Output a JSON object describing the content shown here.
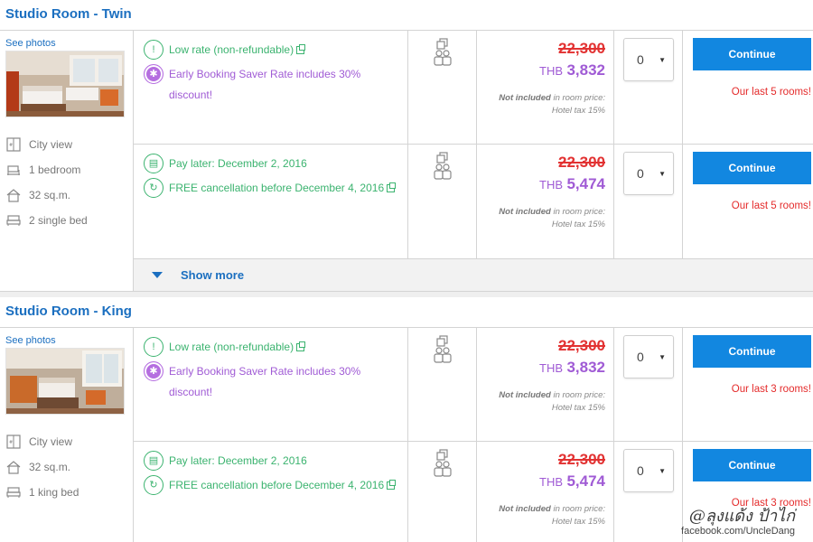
{
  "rooms": [
    {
      "title": "Studio Room - Twin",
      "see_photos": "See photos",
      "features": [
        {
          "icon": "window-icon",
          "label": "City view"
        },
        {
          "icon": "bed-icon",
          "label": "1 bedroom"
        },
        {
          "icon": "house-icon",
          "label": "32 sq.m."
        },
        {
          "icon": "bed-icon",
          "label": "2 single bed"
        }
      ],
      "rates": [
        {
          "conditions": [
            {
              "style": "green",
              "icon": "warning-icon",
              "text": "Low rate (non-refundable)",
              "ext": true
            },
            {
              "style": "purple",
              "icon": "badge-icon",
              "text": "Early Booking Saver Rate includes 30% discount!",
              "ext": false
            }
          ],
          "old_price": "22,300",
          "currency": "THB",
          "price": "3,832",
          "tax_not_included": "Not included",
          "tax_line1": " in room price:",
          "tax_line2": "Hotel tax 15%",
          "qty": "0",
          "cta": "Continue",
          "rooms_left": "Our last 5 rooms!"
        },
        {
          "conditions": [
            {
              "style": "green",
              "icon": "calendar-icon",
              "text": "Pay later: December 2, 2016",
              "ext": false
            },
            {
              "style": "green",
              "icon": "refresh-icon",
              "text": "FREE cancellation before December 4, 2016",
              "ext": true
            }
          ],
          "old_price": "22,300",
          "currency": "THB",
          "price": "5,474",
          "tax_not_included": "Not included",
          "tax_line1": " in room price:",
          "tax_line2": "Hotel tax 15%",
          "qty": "0",
          "cta": "Continue",
          "rooms_left": "Our last 5 rooms!"
        }
      ],
      "show_more": "Show more"
    },
    {
      "title": "Studio Room - King",
      "see_photos": "See photos",
      "features": [
        {
          "icon": "window-icon",
          "label": "City view"
        },
        {
          "icon": "house-icon",
          "label": "32 sq.m."
        },
        {
          "icon": "bed-icon",
          "label": "1 king bed"
        }
      ],
      "rates": [
        {
          "conditions": [
            {
              "style": "green",
              "icon": "warning-icon",
              "text": "Low rate (non-refundable)",
              "ext": true
            },
            {
              "style": "purple",
              "icon": "badge-icon",
              "text": "Early Booking Saver Rate includes 30% discount!",
              "ext": false
            }
          ],
          "old_price": "22,300",
          "currency": "THB",
          "price": "3,832",
          "tax_not_included": "Not included",
          "tax_line1": " in room price:",
          "tax_line2": "Hotel tax 15%",
          "qty": "0",
          "cta": "Continue",
          "rooms_left": "Our last 3 rooms!"
        },
        {
          "conditions": [
            {
              "style": "green",
              "icon": "calendar-icon",
              "text": "Pay later: December 2, 2016",
              "ext": false
            },
            {
              "style": "green",
              "icon": "refresh-icon",
              "text": "FREE cancellation before December 4, 2016",
              "ext": true
            }
          ],
          "old_price": "22,300",
          "currency": "THB",
          "price": "5,474",
          "tax_not_included": "Not included",
          "tax_line1": " in room price:",
          "tax_line2": "Hotel tax 15%",
          "qty": "0",
          "cta": "Continue",
          "rooms_left": "Our last 3 rooms!"
        }
      ]
    }
  ],
  "watermark": {
    "signature": "@ลุงแด้ง ป้าไก่",
    "url": "facebook.com/UncleDang"
  },
  "colors": {
    "title_blue": "#1b6fc0",
    "button_blue": "#1287e0",
    "price_purple": "#a05bd5",
    "strike_red": "#e23232",
    "condition_green": "#3bb36f"
  }
}
